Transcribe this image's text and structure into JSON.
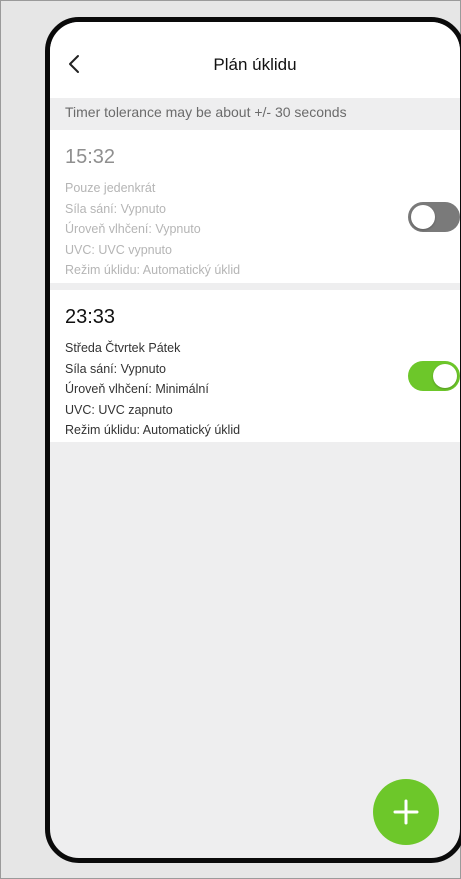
{
  "header": {
    "title": "Plán úklidu",
    "back_icon": "chevron-left-icon"
  },
  "notice": "Timer tolerance may be about +/- 30 seconds",
  "schedules": [
    {
      "time": "15:32",
      "details": [
        "Pouze jedenkrát",
        "Síla sání: Vypnuto",
        "Úroveň vlhčení: Vypnuto",
        "UVC: UVC vypnuto",
        "Režim úklidu: Automatický úklid"
      ],
      "enabled": false
    },
    {
      "time": "23:33",
      "details": [
        "Středa Čtvrtek Pátek",
        "Síla sání: Vypnuto",
        "Úroveň vlhčení: Minimální",
        "UVC: UVC zapnuto",
        "Režim úklidu: Automatický úklid"
      ],
      "enabled": true
    }
  ],
  "add_button_icon": "plus-icon",
  "colors": {
    "accent": "#6dc72a",
    "toggle_off": "#7a7a7a",
    "background": "#eeeeef"
  }
}
